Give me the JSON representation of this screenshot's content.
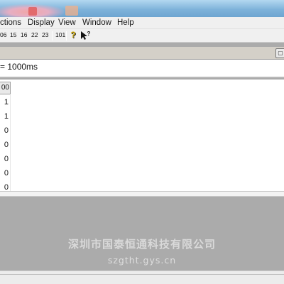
{
  "menubar": {
    "items": [
      "ctions",
      "Display",
      "View",
      "Window",
      "Help"
    ]
  },
  "toolbar": {
    "buttons": [
      "06",
      "15",
      "16",
      "22",
      "23",
      "101"
    ],
    "help_icon": "help-question-icon",
    "whats_this_icon": "whats-this-icon"
  },
  "status": {
    "interval": "= 1000ms"
  },
  "table": {
    "column_header": "00",
    "values": [
      "1",
      "1",
      "0",
      "0",
      "0",
      "0",
      "0"
    ]
  },
  "watermark": {
    "company": "深圳市国泰恒通科技有限公司",
    "url": "szgtht.gys.cn"
  },
  "colors": {
    "titlebar": "#7fb3da",
    "menubar": "#f0f0f0",
    "workspace": "#ababab"
  }
}
